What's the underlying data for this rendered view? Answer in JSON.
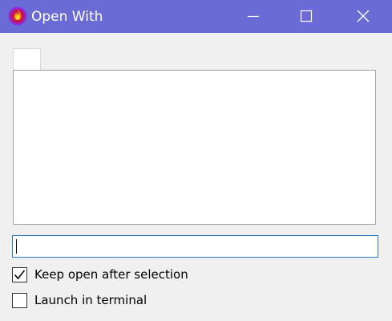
{
  "window": {
    "title": "Open With",
    "icon": "firefox-flame-icon",
    "titlebar_color": "#6b6bd6"
  },
  "command_input": {
    "value": "",
    "focus_color": "#2b7cbf"
  },
  "options": {
    "keep_open": {
      "label": "Keep open after selection",
      "checked": true
    },
    "launch_terminal": {
      "label": "Launch in terminal",
      "checked": false
    }
  }
}
